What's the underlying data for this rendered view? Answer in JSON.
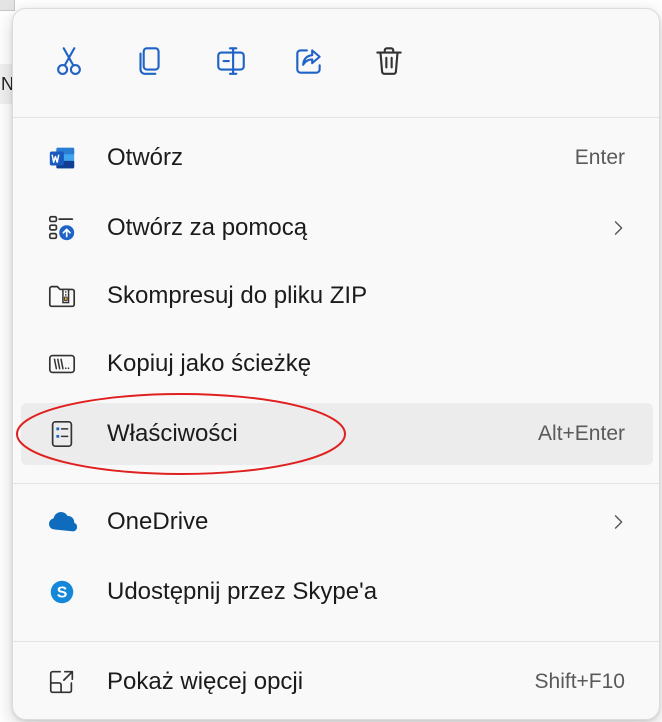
{
  "background": {
    "edge_letter": "N"
  },
  "toolbar": {
    "buttons": [
      {
        "icon": "scissors-icon",
        "action": "cut"
      },
      {
        "icon": "copy-icon",
        "action": "copy"
      },
      {
        "icon": "rename-icon",
        "action": "rename"
      },
      {
        "icon": "share-icon",
        "action": "share"
      },
      {
        "icon": "trash-icon",
        "action": "delete"
      }
    ],
    "accent_color": "#1f63c6"
  },
  "menu": {
    "items": [
      {
        "label": "Otwórz",
        "shortcut": "Enter",
        "icon": "word-icon"
      },
      {
        "label": "Otwórz za pomocą",
        "submenu": true,
        "icon": "open-with-icon"
      },
      {
        "label": "Skompresuj do pliku ZIP",
        "icon": "zip-folder-icon"
      },
      {
        "label": "Kopiuj jako ścieżkę",
        "icon": "copy-path-icon"
      },
      {
        "label": "Właściwości",
        "shortcut": "Alt+Enter",
        "icon": "properties-icon",
        "highlighted": true
      }
    ],
    "items2": [
      {
        "label": "OneDrive",
        "submenu": true,
        "icon": "onedrive-icon"
      },
      {
        "label": "Udostępnij przez Skype'a",
        "icon": "skype-icon"
      }
    ],
    "items3": [
      {
        "label": "Pokaż więcej opcji",
        "shortcut": "Shift+F10",
        "icon": "show-more-icon"
      }
    ]
  },
  "colors": {
    "menu_bg": "#f9f9f9",
    "hover_bg": "#ececec",
    "annotation": "#e0201f",
    "word_blue": "#185abd",
    "onedrive_blue": "#0f6cbd",
    "skype_blue": "#1487d9"
  }
}
